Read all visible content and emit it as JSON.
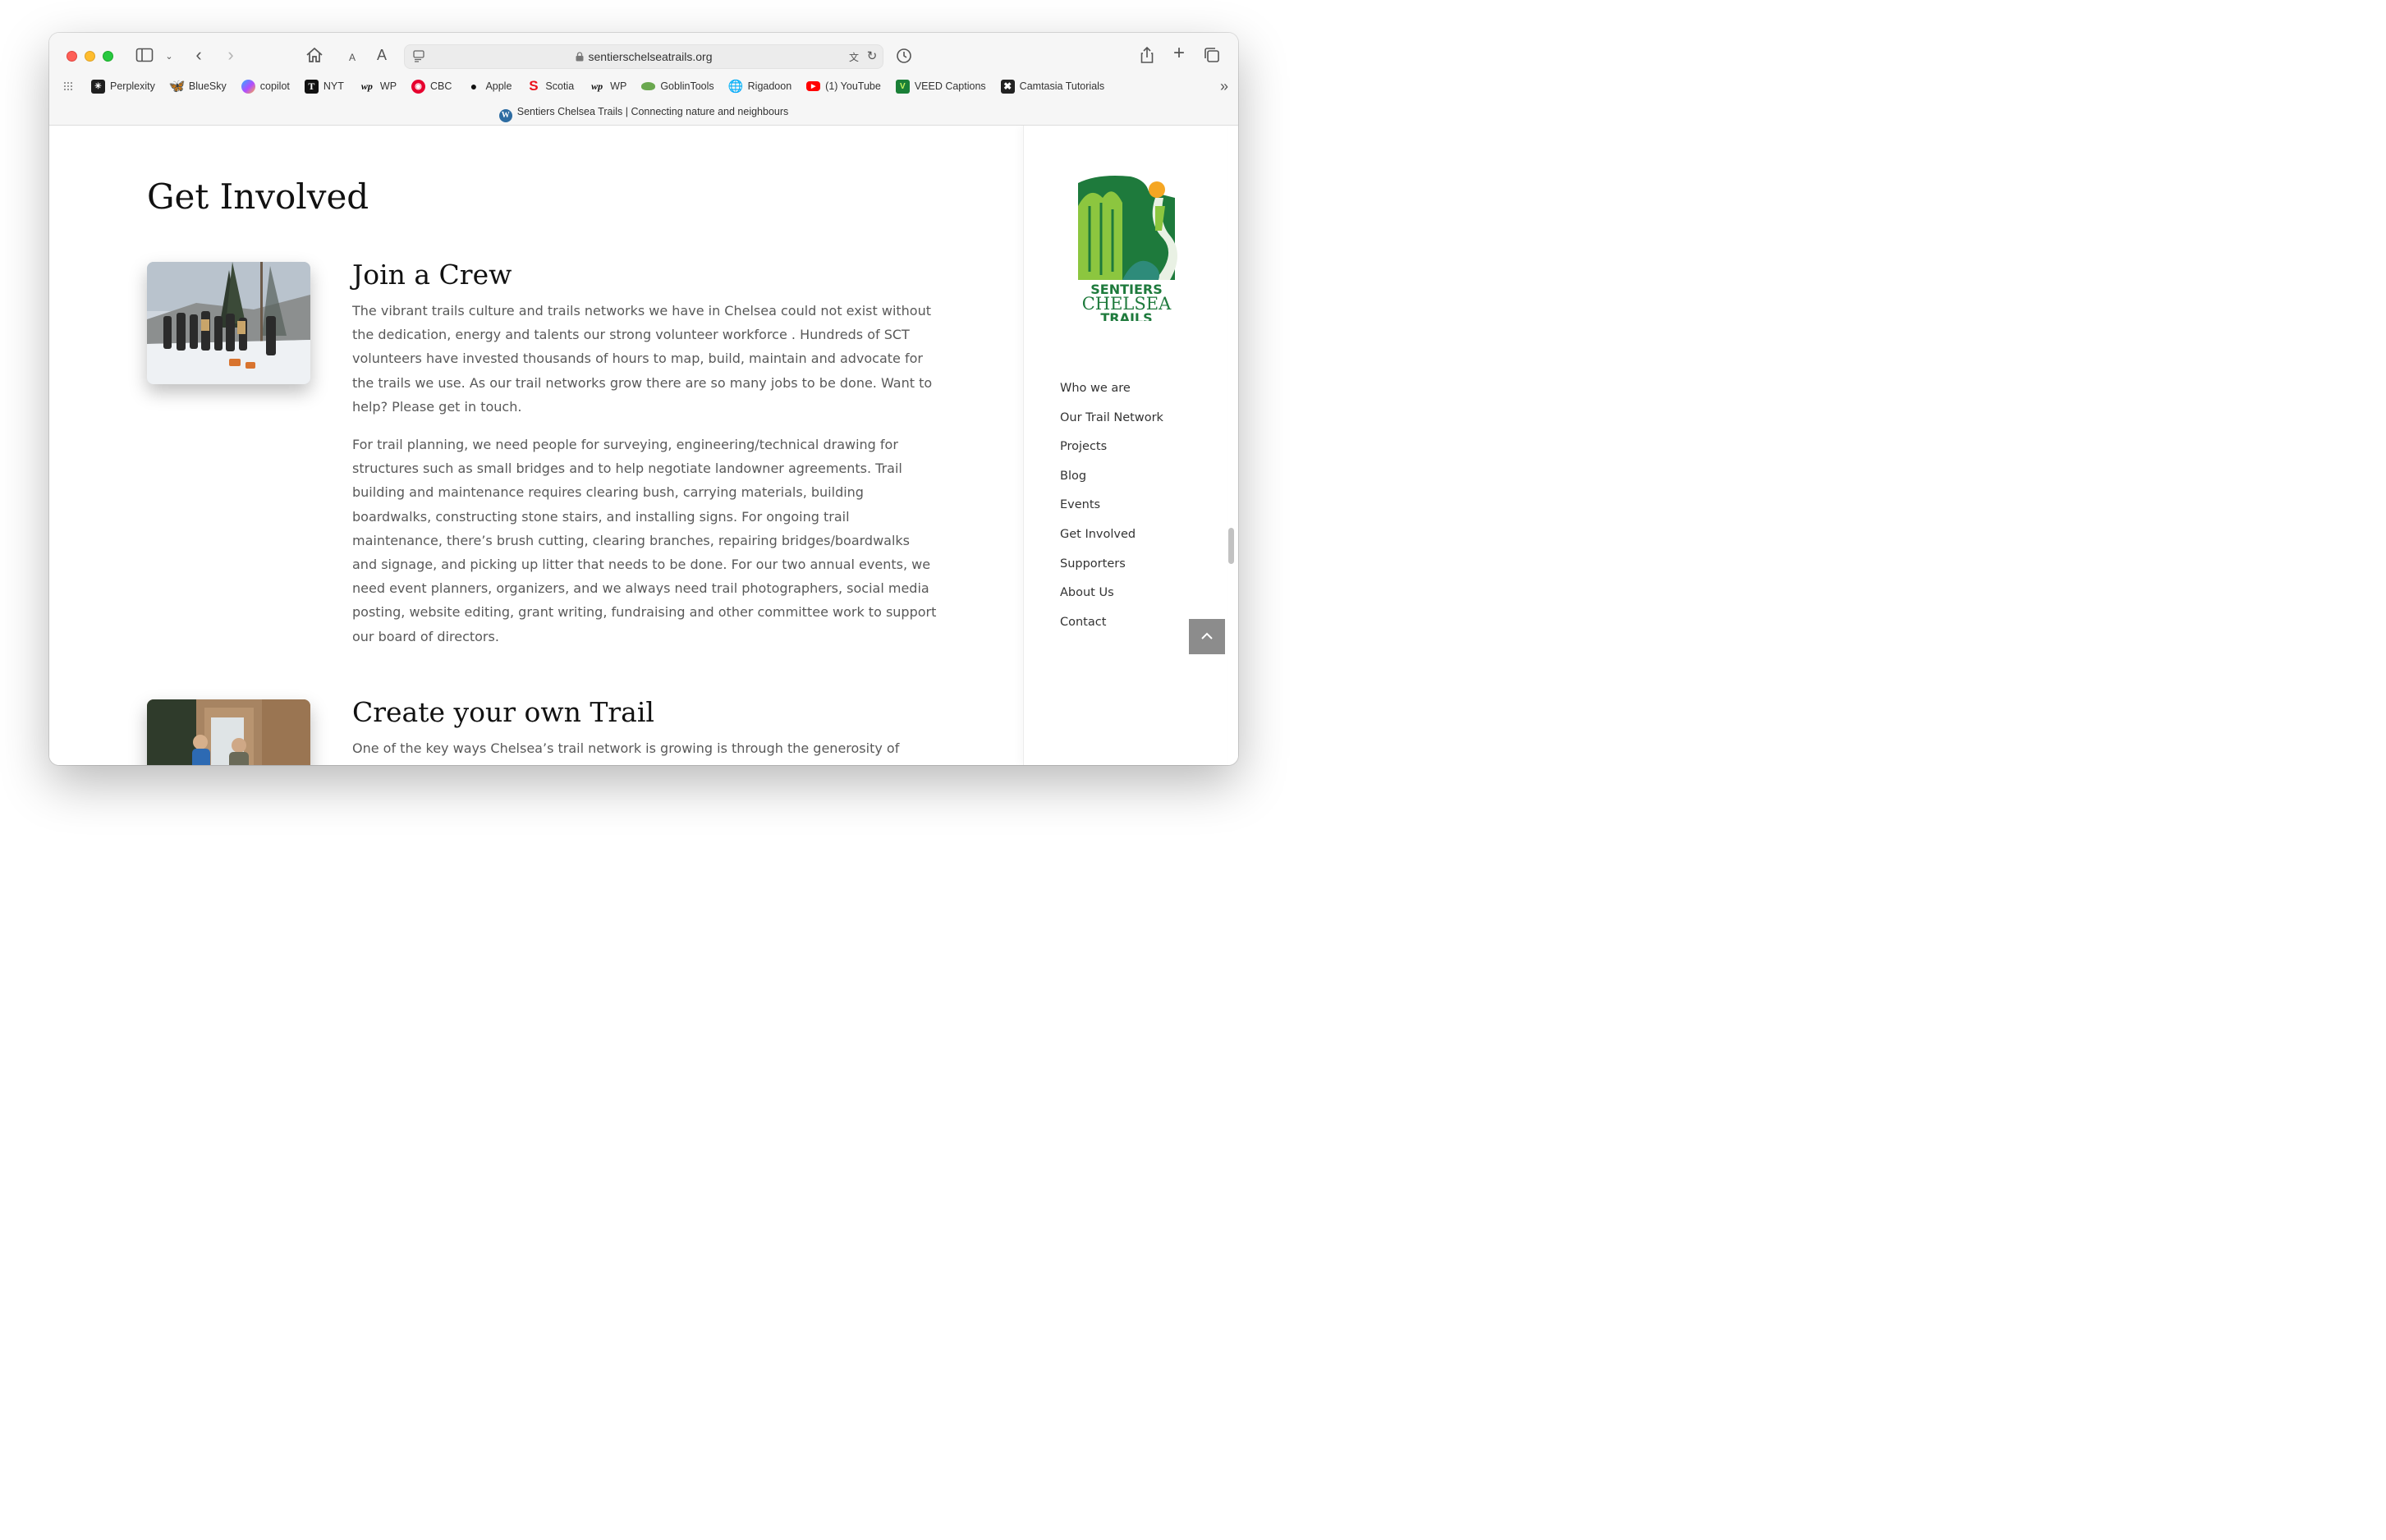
{
  "browser": {
    "url": "sentierschelseatrails.org",
    "tab_title": "Sentiers Chelsea Trails | Connecting nature and neighbours",
    "text_small_label": "A",
    "text_large_label": "A",
    "bookmarks": [
      {
        "label": "Perplexity",
        "icon": "perplexity-icon",
        "color": "#1f1f1f"
      },
      {
        "label": "BlueSky",
        "icon": "bluesky-icon",
        "color": "#1185fe"
      },
      {
        "label": "copilot",
        "icon": "copilot-icon",
        "color": "#7b61ff"
      },
      {
        "label": "NYT",
        "icon": "nyt-icon",
        "color": "#111111"
      },
      {
        "label": "WP",
        "icon": "wp-icon",
        "color": "#111111"
      },
      {
        "label": "CBC",
        "icon": "cbc-icon",
        "color": "#e6002e"
      },
      {
        "label": "Apple",
        "icon": "apple-icon",
        "color": "#111111"
      },
      {
        "label": "Scotia",
        "icon": "scotia-icon",
        "color": "#ec111a"
      },
      {
        "label": "WP",
        "icon": "wp-icon",
        "color": "#111111"
      },
      {
        "label": "GoblinTools",
        "icon": "goblintools-icon",
        "color": "#6aa84f"
      },
      {
        "label": "Rigadoon",
        "icon": "globe-icon",
        "color": "#777777"
      },
      {
        "label": "(1) YouTube",
        "icon": "youtube-icon",
        "color": "#ff0000"
      },
      {
        "label": "VEED Captions",
        "icon": "veed-icon",
        "color": "#1a7f37"
      },
      {
        "label": "Camtasia Tutorials",
        "icon": "camtasia-icon",
        "color": "#222222"
      }
    ]
  },
  "page": {
    "title": "Get Involved",
    "sections": [
      {
        "heading": "Join a Crew",
        "paragraphs": [
          "The vibrant trails culture and trails networks we have in Chelsea could not exist without the dedication, energy and talents our strong volunteer workforce . Hundreds of SCT volunteers have invested thousands of hours to map, build, maintain and advocate for the trails we use. As our trail networks grow there are so many jobs to be done. Want to help?  Please get in touch.",
          "For trail planning, we need people for surveying, engineering/technical drawing for structures such as small bridges and to help negotiate landowner agreements.  Trail building and maintenance requires clearing bush, carrying materials, building boardwalks, constructing stone stairs, and installing signs.  For ongoing trail maintenance, there’s brush cutting, clearing branches, repairing bridges/boardwalks and signage, and picking up litter that needs to be done. For our two annual events,  we need event planners, organizers,  and we always need trail photographers, social media posting, website editing, grant writing, fundraising and other committee work to support our board of directors."
        ]
      },
      {
        "heading": "Create your own Trail",
        "paragraphs": [
          "One of the key ways Chelsea’s trail network is growing is through the generosity of some"
        ]
      }
    ]
  },
  "sidebar": {
    "logo_lines": [
      "SENTIERS",
      "CHELSEA",
      "TRAILS"
    ],
    "nav": [
      "Who we are",
      "Our Trail Network",
      "Projects",
      "Blog",
      "Events",
      "Get Involved",
      "Supporters",
      "About Us",
      "Contact"
    ]
  },
  "colors": {
    "logo_green": "#1e7a3c",
    "logo_light_green": "#8cc63f",
    "logo_teal": "#2e8b7a",
    "logo_sun": "#f5a623"
  }
}
